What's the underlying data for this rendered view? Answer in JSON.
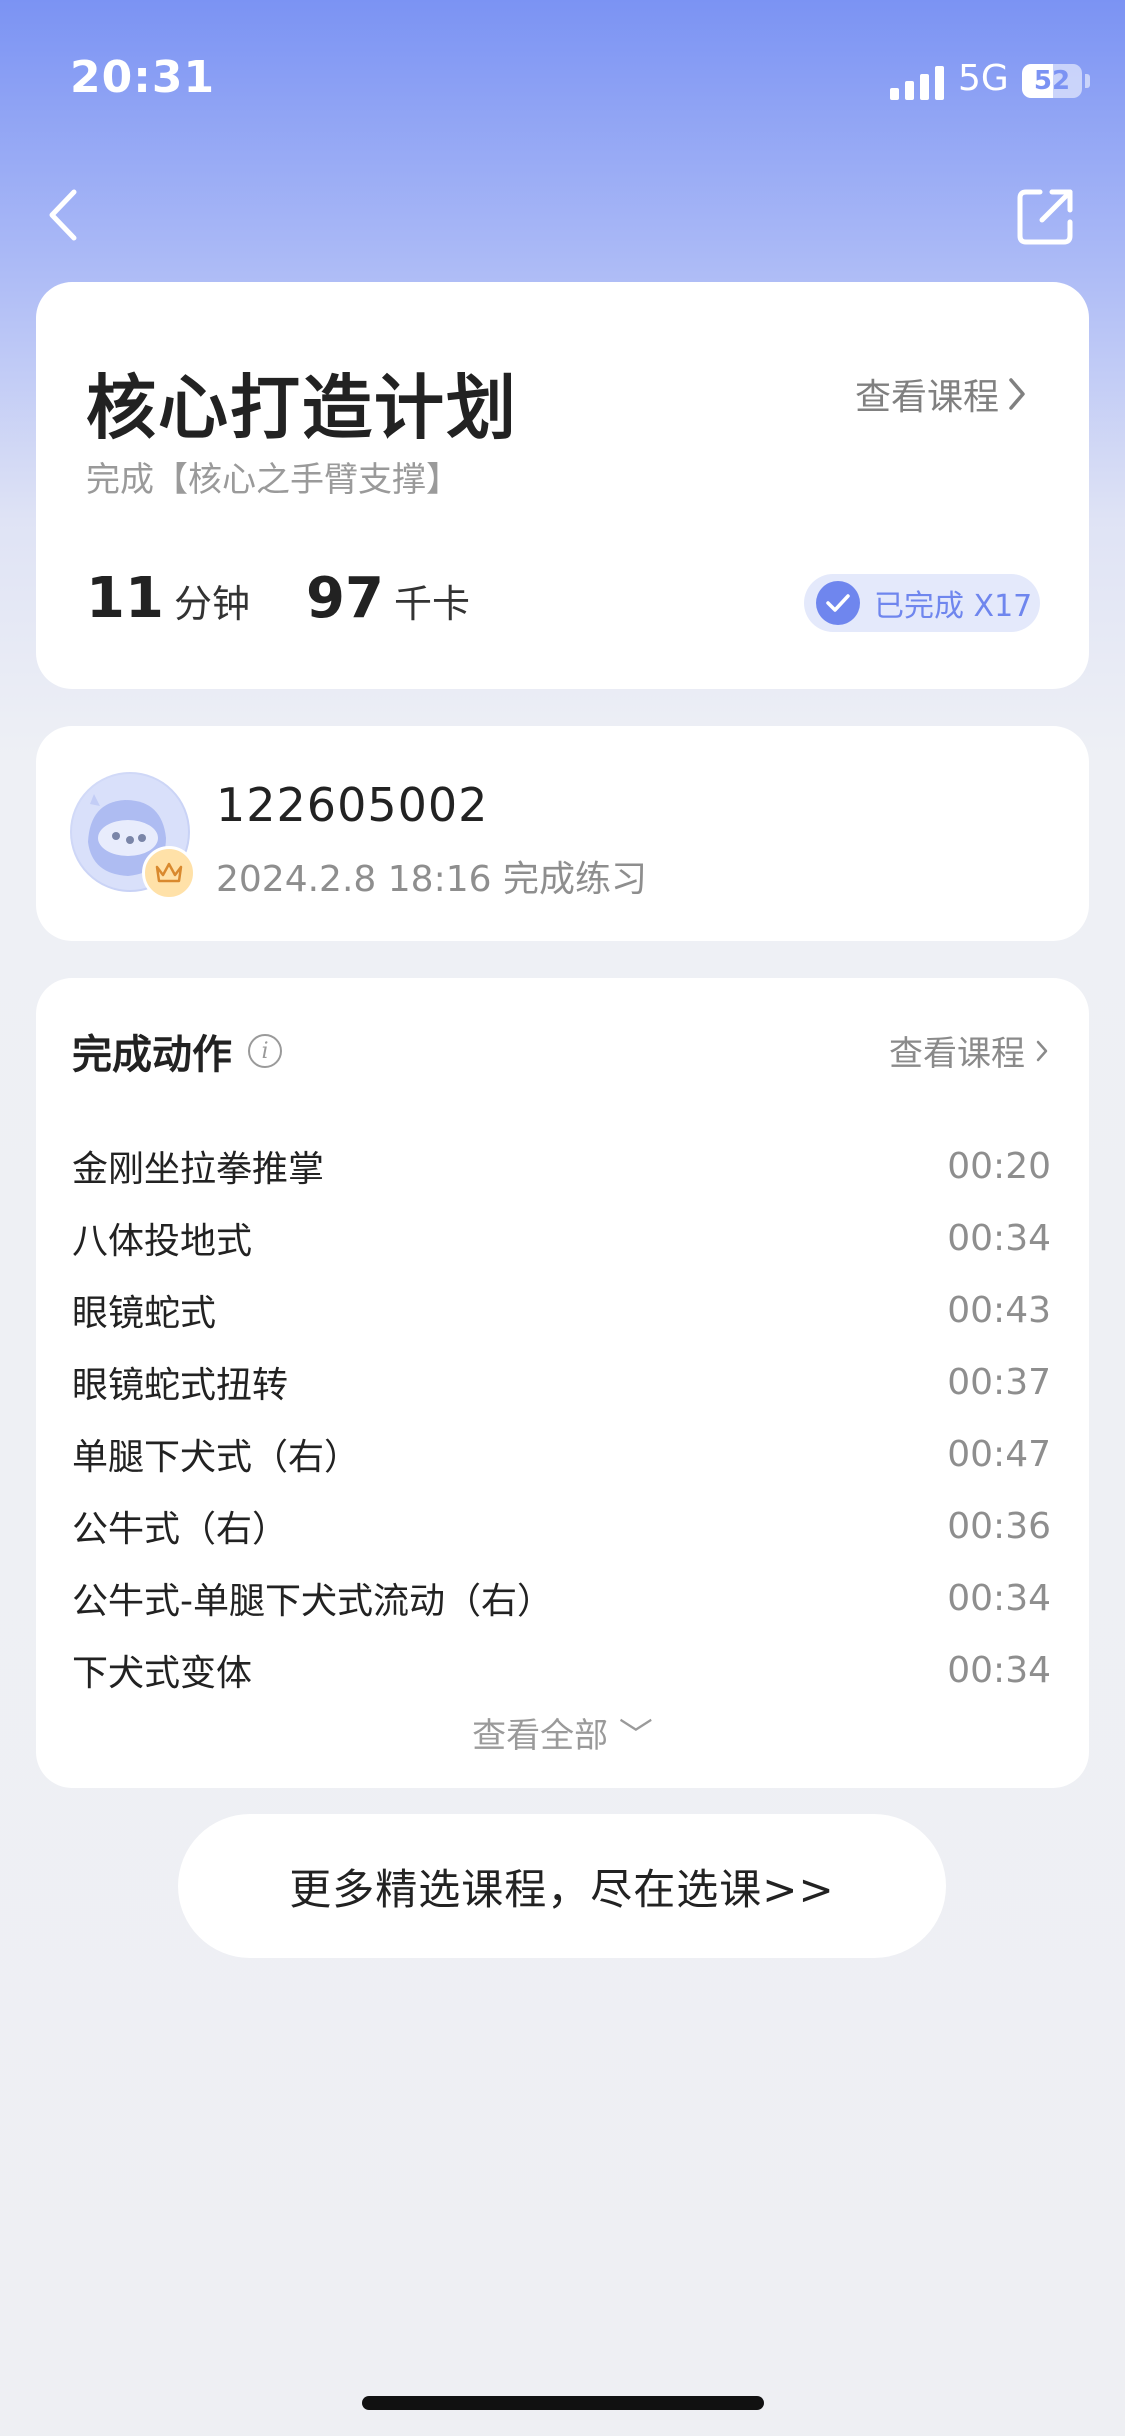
{
  "status_bar": {
    "time": "20:31",
    "network": "5G",
    "battery": "52",
    "battery_level": 0.52
  },
  "nav": {
    "back_icon": "chevron-left-icon",
    "share_icon": "share-external-icon"
  },
  "plan": {
    "title": "核心打造计划",
    "subtitle": "完成【核心之手臂支撑】",
    "view_course_label": "查看课程",
    "minutes_value": "11",
    "minutes_unit": "分钟",
    "kcal_value": "97",
    "kcal_unit": "千卡",
    "completed_label": "已完成 X17"
  },
  "user": {
    "id": "122605002",
    "completed_text": "2024.2.8 18:16  完成练习"
  },
  "actions": {
    "title": "完成动作",
    "view_course_label": "查看课程",
    "items": [
      {
        "name": "金刚坐拉拳推掌",
        "duration": "00:20"
      },
      {
        "name": "八体投地式",
        "duration": "00:34"
      },
      {
        "name": "眼镜蛇式",
        "duration": "00:43"
      },
      {
        "name": "眼镜蛇式扭转",
        "duration": "00:37"
      },
      {
        "name": "单腿下犬式（右）",
        "duration": "00:47"
      },
      {
        "name": "公牛式（右）",
        "duration": "00:36"
      },
      {
        "name": "公牛式-单腿下犬式流动（右）",
        "duration": "00:34"
      },
      {
        "name": "下犬式变体",
        "duration": "00:34"
      }
    ],
    "view_all_label": "查看全部 ﹀"
  },
  "more_courses_label": "更多精选课程，尽在选课>>",
  "colors": {
    "accent": "#6f86ee",
    "header_gradient_top": "#7b93f3",
    "background": "#eeeff3"
  }
}
